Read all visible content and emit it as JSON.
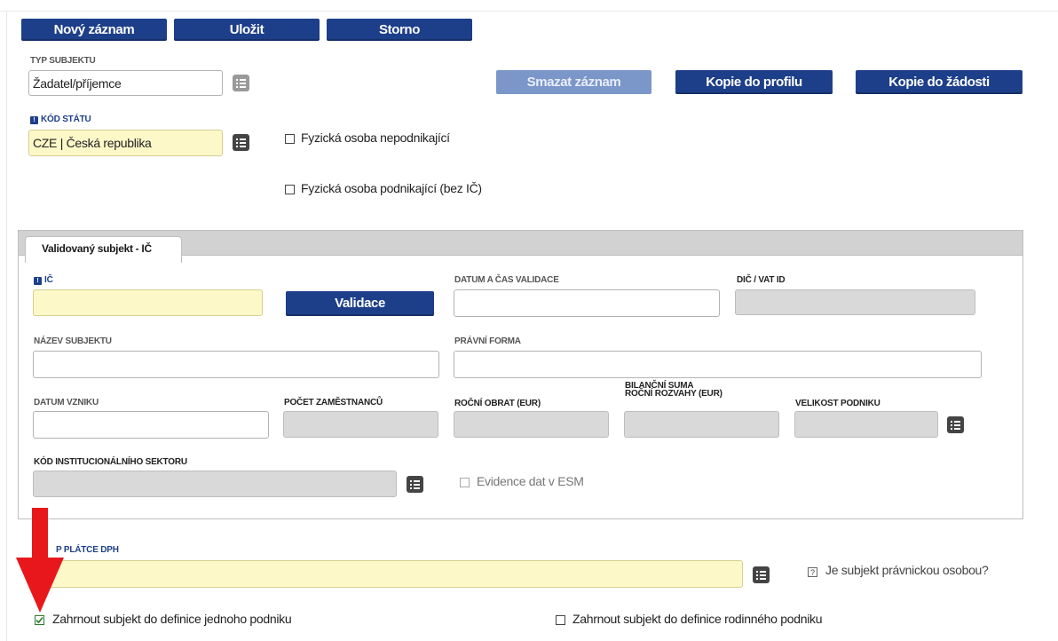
{
  "toolbar": {
    "new_label": "Nový záznam",
    "save_label": "Uložit",
    "cancel_label": "Storno"
  },
  "actions": {
    "delete_label": "Smazat záznam",
    "copy_profile_label": "Kopie do profilu",
    "copy_request_label": "Kopie do žádosti"
  },
  "subject_type": {
    "label": "TYP SUBJEKTU",
    "value": "Žadatel/příjemce"
  },
  "country_code": {
    "label": "KÓD STÁTU",
    "value": "CZE | Česká republika"
  },
  "checkboxes": {
    "natural_person_non_business": "Fyzická osoba nepodnikající",
    "natural_person_business": "Fyzická osoba podnikající (bez IČ)"
  },
  "tab": {
    "label": "Validovaný subjekt - IČ"
  },
  "form": {
    "ic_label": "IČ",
    "validate_label": "Validace",
    "validation_datetime_label": "DATUM A ČAS VALIDACE",
    "dic_label": "DIČ / VAT ID",
    "subject_name_label": "NÁZEV SUBJEKTU",
    "legal_form_label": "PRÁVNÍ FORMA",
    "founding_date_label": "DATUM VZNIKU",
    "employee_count_label": "POČET ZAMĚSTNANCŮ",
    "annual_turnover_label": "ROČNÍ OBRAT (EUR)",
    "balance_sheet_label_line1": "BILANČNÍ SUMA",
    "balance_sheet_label_line2": "ROČNÍ ROZVAHY (EUR)",
    "company_size_label": "VELIKOST PODNIKU",
    "sector_code_label": "KÓD INSTITUCIONÁLNÍHO SEKTORU",
    "esm_label": "Evidence dat v ESM"
  },
  "vat": {
    "label_visible": "P PLÁTCE DPH"
  },
  "legal_person_question": "Je subjekt právnickou osobou?",
  "include_single_enterprise": "Zahrnout subjekt do definice jednoho podniku",
  "include_family_enterprise": "Zahrnout subjekt do definice rodinného podniku",
  "colors": {
    "primary": "#1d3f8a",
    "required_field": "#fdf8c8",
    "readonly_field": "#d9d9d9",
    "annotation_arrow": "#e8171b"
  }
}
